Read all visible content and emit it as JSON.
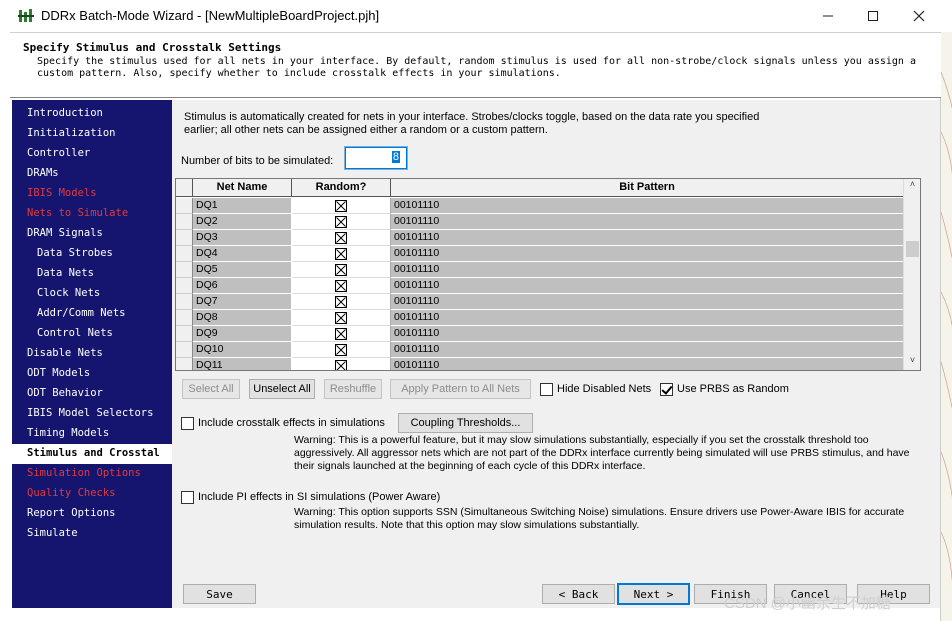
{
  "window": {
    "title": "DDRx Batch-Mode Wizard - [NewMultipleBoardProject.pjh]"
  },
  "header": {
    "title": "Specify Stimulus and Crosstalk Settings",
    "description": "Specify the stimulus used for all nets in your interface.  By default, random stimulus is used for all non-strobe/clock signals unless you assign a custom pattern.  Also, specify whether to include crosstalk effects in your simulations."
  },
  "sidebar": {
    "items": [
      {
        "label": "Introduction",
        "state": "normal",
        "indent": false
      },
      {
        "label": "Initialization",
        "state": "normal",
        "indent": false
      },
      {
        "label": "Controller",
        "state": "normal",
        "indent": false
      },
      {
        "label": "DRAMs",
        "state": "normal",
        "indent": false
      },
      {
        "label": "IBIS Models",
        "state": "warn",
        "indent": false
      },
      {
        "label": "Nets to Simulate",
        "state": "warn",
        "indent": false
      },
      {
        "label": "DRAM Signals",
        "state": "normal",
        "indent": false
      },
      {
        "label": "Data Strobes",
        "state": "normal",
        "indent": true
      },
      {
        "label": "Data Nets",
        "state": "normal",
        "indent": true
      },
      {
        "label": "Clock Nets",
        "state": "normal",
        "indent": true
      },
      {
        "label": "Addr/Comm Nets",
        "state": "normal",
        "indent": true
      },
      {
        "label": "Control Nets",
        "state": "normal",
        "indent": true
      },
      {
        "label": "Disable Nets",
        "state": "normal",
        "indent": false
      },
      {
        "label": "ODT Models",
        "state": "normal",
        "indent": false
      },
      {
        "label": "ODT Behavior",
        "state": "normal",
        "indent": false
      },
      {
        "label": "IBIS Model Selectors",
        "state": "normal",
        "indent": false
      },
      {
        "label": "Timing Models",
        "state": "normal",
        "indent": false
      },
      {
        "label": "Stimulus and Crosstal",
        "state": "active",
        "indent": false
      },
      {
        "label": "Simulation Options",
        "state": "warn",
        "indent": false
      },
      {
        "label": "Quality Checks",
        "state": "warn",
        "indent": false
      },
      {
        "label": "Report Options",
        "state": "normal",
        "indent": false
      },
      {
        "label": "Simulate",
        "state": "normal",
        "indent": false
      }
    ]
  },
  "main": {
    "intro": "Stimulus is automatically created for nets in your interface.  Strobes/clocks toggle, based on the data rate you specified earlier; all other nets can be assigned either a random or a custom pattern.",
    "bits_label": "Number of bits to be simulated:",
    "bits_value": "8"
  },
  "table": {
    "columns": [
      "Net Name",
      "Random?",
      "Bit Pattern"
    ],
    "rows": [
      {
        "name": "DQ1",
        "random": true,
        "pattern": "00101110"
      },
      {
        "name": "DQ2",
        "random": true,
        "pattern": "00101110"
      },
      {
        "name": "DQ3",
        "random": true,
        "pattern": "00101110"
      },
      {
        "name": "DQ4",
        "random": true,
        "pattern": "00101110"
      },
      {
        "name": "DQ5",
        "random": true,
        "pattern": "00101110"
      },
      {
        "name": "DQ6",
        "random": true,
        "pattern": "00101110"
      },
      {
        "name": "DQ7",
        "random": true,
        "pattern": "00101110"
      },
      {
        "name": "DQ8",
        "random": true,
        "pattern": "00101110"
      },
      {
        "name": "DQ9",
        "random": true,
        "pattern": "00101110"
      },
      {
        "name": "DQ10",
        "random": true,
        "pattern": "00101110"
      },
      {
        "name": "DQ11",
        "random": true,
        "pattern": "00101110"
      }
    ]
  },
  "actions": {
    "select_all": "Select All",
    "unselect_all": "Unselect All",
    "reshuffle": "Reshuffle",
    "apply_pattern": "Apply Pattern to All Nets",
    "hide_disabled": "Hide Disabled Nets",
    "hide_disabled_checked": false,
    "use_prbs": "Use PRBS as Random",
    "use_prbs_checked": true
  },
  "crosstalk": {
    "label": "Include crosstalk effects in simulations",
    "checked": false,
    "thresholds_button": "Coupling Thresholds...",
    "warning": "Warning:  This is a powerful feature, but it may slow simulations substantially, especially if you set the crosstalk threshold too aggressively.  All aggressor nets which are not part of the DDRx interface currently being simulated will use PRBS stimulus, and have their signals launched at the beginning of each cycle of this DDRx interface."
  },
  "pi": {
    "label": "Include PI effects in SI simulations (Power Aware)",
    "checked": false,
    "warning": "Warning: This option supports SSN (Simultaneous Switching Noise) simulations.  Ensure drivers use Power-Aware IBIS for accurate simulation results.  Note that this option may slow simulations substantially."
  },
  "footer": {
    "save": "Save",
    "back": "< Back",
    "next": "Next >",
    "finish": "Finish",
    "cancel": "Cancel",
    "help": "Help"
  },
  "watermark": "CSDN @小幽余生不加糖",
  "colors": {
    "sidebar_bg": "#15156f",
    "warn": "#e23a3a",
    "accent": "#0078d7",
    "cell_gray": "#bfbfbf"
  }
}
